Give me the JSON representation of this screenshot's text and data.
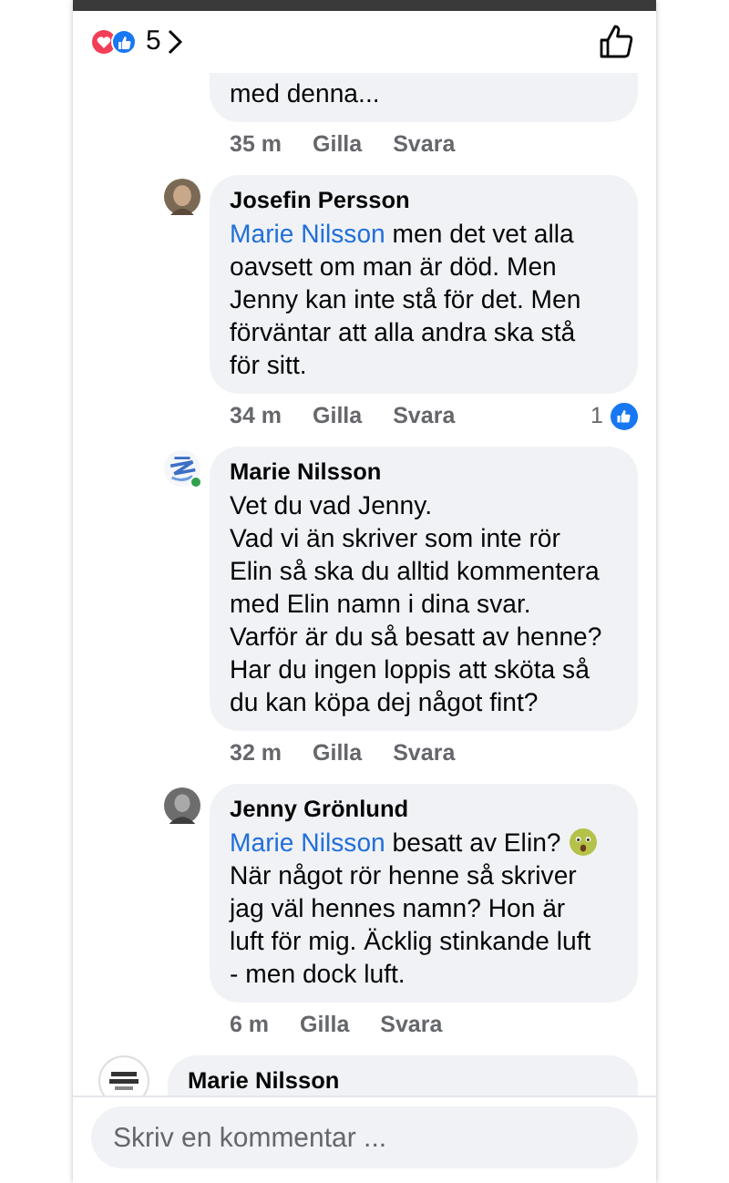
{
  "header": {
    "reaction_count": "5"
  },
  "comments": [
    {
      "kind": "cut",
      "text": "med denna...",
      "time": "35 m",
      "like": "Gilla",
      "reply": "Svara"
    },
    {
      "kind": "reply",
      "online": false,
      "name": "Josefin Persson",
      "mention": "Marie Nilsson",
      "text": "men det vet alla oavsett om man är död. Men Jenny kan inte stå för det. Men förväntar att alla andra ska stå för sitt.",
      "time": "34 m",
      "like": "Gilla",
      "reply": "Svara",
      "likes": "1"
    },
    {
      "kind": "reply",
      "online": true,
      "name": "Marie Nilsson",
      "text": "Vet du vad Jenny.\nVad vi än skriver som inte rör Elin så ska du alltid kommentera med Elin namn i dina svar. Varför är du så besatt av henne? Har du ingen loppis att sköta så du kan köpa dej något fint?",
      "time": "32 m",
      "like": "Gilla",
      "reply": "Svara"
    },
    {
      "kind": "reply",
      "online": false,
      "name": "Jenny Grönlund",
      "mention": "Marie Nilsson",
      "text": "besatt av Elin?",
      "emoji": true,
      "text2": "När något rör henne så skriver jag väl hennes namn? Hon är luft för mig. Äcklig stinkande luft - men dock luft.",
      "time": "6 m",
      "like": "Gilla",
      "reply": "Svara"
    },
    {
      "kind": "top",
      "online": false,
      "name": "Marie Nilsson"
    }
  ],
  "composer": {
    "placeholder": "Skriv en kommentar ..."
  }
}
